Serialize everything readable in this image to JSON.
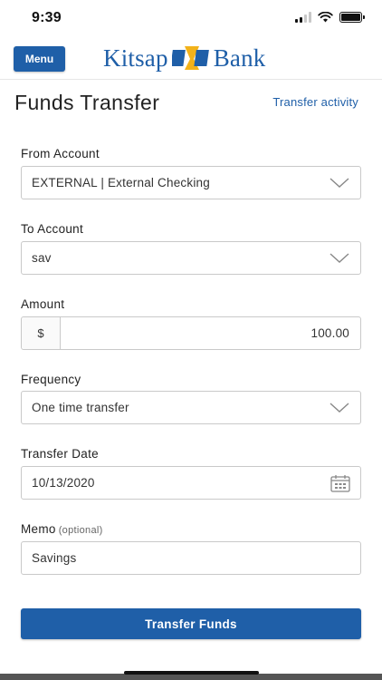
{
  "status_bar": {
    "time": "9:39"
  },
  "header": {
    "menu_label": "Menu",
    "logo_left": "Kitsap",
    "logo_right": "Bank",
    "brand_color": "#1f5fa8"
  },
  "page": {
    "title": "Funds Transfer",
    "activity_link": "Transfer activity"
  },
  "form": {
    "from": {
      "label": "From Account",
      "value": "EXTERNAL | External Checking"
    },
    "to": {
      "label": "To Account",
      "value": "sav"
    },
    "amount": {
      "label": "Amount",
      "prefix": "$",
      "value": "100.00"
    },
    "frequency": {
      "label": "Frequency",
      "value": "One time transfer"
    },
    "date": {
      "label": "Transfer Date",
      "value": "10/13/2020"
    },
    "memo": {
      "label": "Memo",
      "optional": "(optional)",
      "value": "Savings"
    },
    "submit_label": "Transfer Funds"
  },
  "icons": {
    "chevron": "chevron-down-icon",
    "calendar": "calendar-icon",
    "signal": "signal-icon",
    "wifi": "wifi-icon",
    "battery": "battery-icon"
  }
}
